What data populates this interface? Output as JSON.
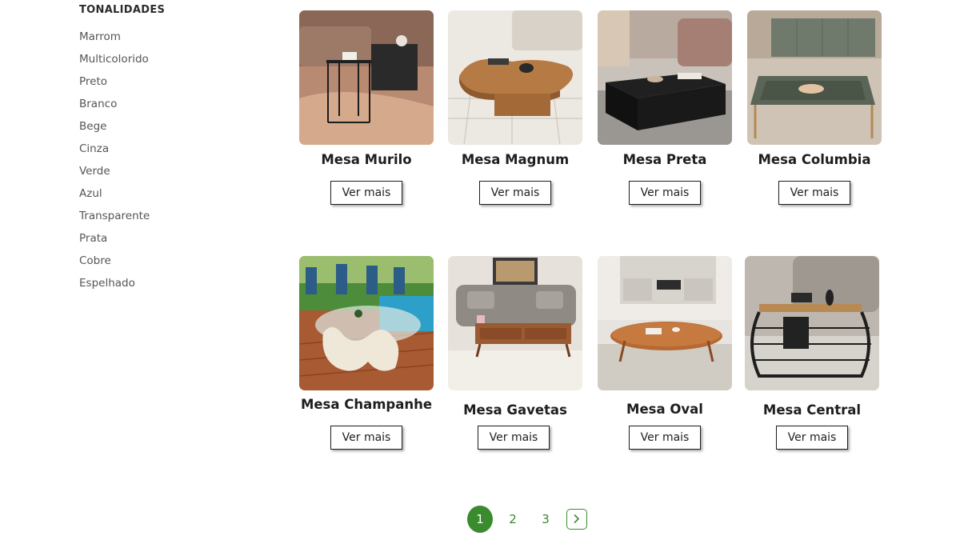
{
  "sidebar": {
    "title": "TONALIDADES",
    "items": [
      {
        "label": "Marrom"
      },
      {
        "label": "Multicolorido"
      },
      {
        "label": "Preto"
      },
      {
        "label": "Branco"
      },
      {
        "label": "Bege"
      },
      {
        "label": "Cinza"
      },
      {
        "label": "Verde"
      },
      {
        "label": "Azul"
      },
      {
        "label": "Transparente"
      },
      {
        "label": "Prata"
      },
      {
        "label": "Cobre"
      },
      {
        "label": "Espelhado"
      }
    ]
  },
  "products": [
    {
      "name": "Mesa Murilo",
      "button": "Ver mais"
    },
    {
      "name": "Mesa Magnum",
      "button": "Ver mais"
    },
    {
      "name": "Mesa Preta",
      "button": "Ver mais"
    },
    {
      "name": "Mesa Columbia",
      "button": "Ver mais"
    },
    {
      "name": "Mesa Champanhe",
      "button": "Ver mais"
    },
    {
      "name": "Mesa Gavetas",
      "button": "Ver mais"
    },
    {
      "name": "Mesa Oval",
      "button": "Ver mais"
    },
    {
      "name": "Mesa Central",
      "button": "Ver mais"
    }
  ],
  "pagination": {
    "pages": [
      "1",
      "2",
      "3"
    ],
    "current": "1"
  },
  "colors": {
    "accent": "#3a8a2e"
  }
}
